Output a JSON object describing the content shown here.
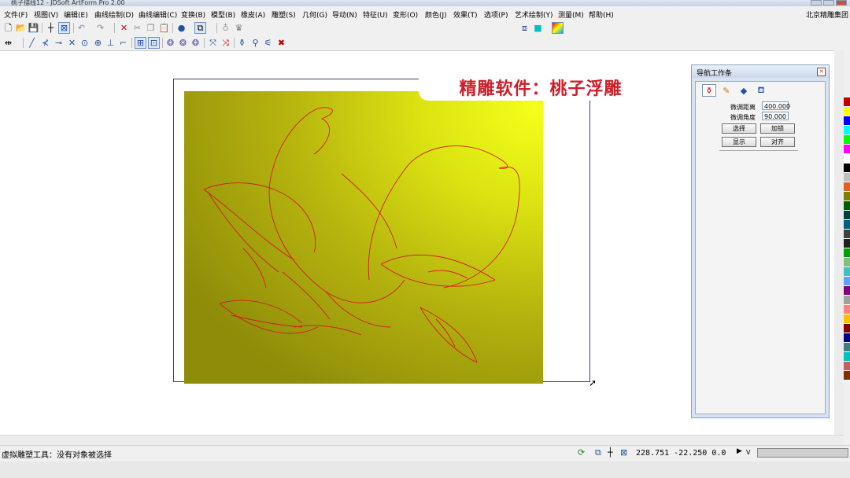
{
  "window": {
    "title": "桃子描线12 - JDSoft ArtForm Pro 2.00"
  },
  "menu": {
    "items": [
      "文件(F)",
      "视图(V)",
      "编辑(E)",
      "曲线绘制(D)",
      "曲线编辑(C)",
      "变换(B)",
      "模型(B)",
      "橡皮(A)",
      "雕塑(S)",
      "几何(G)",
      "导动(N)",
      "特征(U)",
      "变形(O)",
      "颜色(J)",
      "效果(T)",
      "选项(P)",
      "艺术绘制(Y)",
      "测量(M)",
      "帮助(H)"
    ],
    "company": "北京精雕集团"
  },
  "caption": "精雕软件：桃子浮雕",
  "panel": {
    "title": "导航工作条",
    "fine_distance_label": "微调距离",
    "fine_distance_value": "400.000",
    "fine_angle_label": "微调角度",
    "fine_angle_value": "90.000",
    "btn_select": "选择",
    "btn_lock": "加锁",
    "btn_show": "显示",
    "btn_align": "对齐"
  },
  "status": {
    "message": "虚拟雕塑工具：没有对象被选择",
    "coords": "228.751 -22.250 0.0",
    "mode": "V"
  },
  "icons": {
    "toolbar1": [
      "new-file-icon",
      "open-folder-icon",
      "save-icon",
      "crosshair-icon",
      "box-select-icon",
      "undo-icon",
      "redo-icon",
      "delete-icon",
      "cut-icon",
      "copy-icon",
      "paste-icon",
      "sphere-icon",
      "cube-icon",
      "cup-icon",
      "cup-shaded-icon",
      "cube-view-icon",
      "color-box-icon",
      "gradient-icon"
    ],
    "toolbar2": [
      "arrow-both-icon",
      "line-tool-icon",
      "angle-tool-icon",
      "trim-icon",
      "cross-icon",
      "circle-dot-icon",
      "target-icon",
      "perpendicular-icon",
      "tangent-icon",
      "grid-snap-icon",
      "grid-dots-icon",
      "relief-1-icon",
      "relief-2-icon",
      "relief-3-icon",
      "node-edit-icon",
      "node-delete-icon",
      "sculpt-1-icon",
      "sculpt-2-icon",
      "sculpt-3-icon",
      "close-red-icon"
    ]
  },
  "palette": [
    "#c00000",
    "#ffff00",
    "#0000ff",
    "#00ffff",
    "#00ff00",
    "#ff00ff",
    "#ffffff",
    "#000000",
    "#c0c0c0",
    "#e06020",
    "#808000",
    "#006000",
    "#004040",
    "#006080",
    "#404040",
    "#202020",
    "#00a000",
    "#80c080",
    "#40c0c0",
    "#60a0ff",
    "#800080",
    "#a0a0a0",
    "#ff8080",
    "#ffc000",
    "#800000",
    "#000080",
    "#408080",
    "#00c0c0",
    "#c06060",
    "#803000"
  ]
}
